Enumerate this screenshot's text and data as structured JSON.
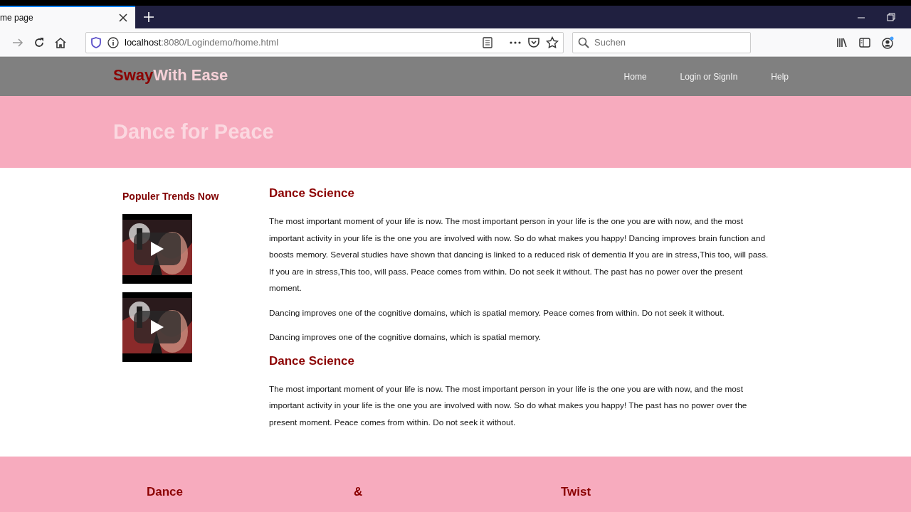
{
  "browser": {
    "tab": {
      "title": "me page"
    },
    "url": {
      "host": "localhost",
      "rest": ":8080/Logindemo/home.html"
    },
    "search": {
      "placeholder": "Suchen"
    }
  },
  "site": {
    "logo": {
      "first": "Sway",
      "rest": "With Ease"
    },
    "nav": [
      {
        "label": "Home"
      },
      {
        "label": "Login or SignIn"
      },
      {
        "label": "Help"
      }
    ],
    "hero": {
      "title": "Dance for Peace"
    },
    "sidebar": {
      "title": "Populer Trends Now"
    },
    "sections": [
      {
        "heading": "Dance Science",
        "paragraphs": [
          "The most important moment of your life is now. The most important person in your life is the one you are with now, and the most important activity in your life is the one you are involved with now. So do what makes you happy! Dancing improves brain function and boosts memory. Several studies have shown that dancing is linked to a reduced risk of dementia If you are in stress,This too, will pass. If you are in stress,This too, will pass. Peace comes from within. Do not seek it without. The past has no power over the present moment.",
          "Dancing improves one of the cognitive domains, which is spatial memory. Peace comes from within. Do not seek it without.",
          "Dancing improves one of the cognitive domains, which is spatial memory."
        ]
      },
      {
        "heading": "Dance Science",
        "paragraphs": [
          "The most important moment of your life is now. The most important person in your life is the one you are with now, and the most important activity in your life is the one you are involved with now. So do what makes you happy! The past has no power over the present moment. Peace comes from within. Do not seek it without."
        ]
      }
    ],
    "footer": [
      {
        "label": "Dance"
      },
      {
        "label": "&"
      },
      {
        "label": "Twist"
      }
    ]
  }
}
